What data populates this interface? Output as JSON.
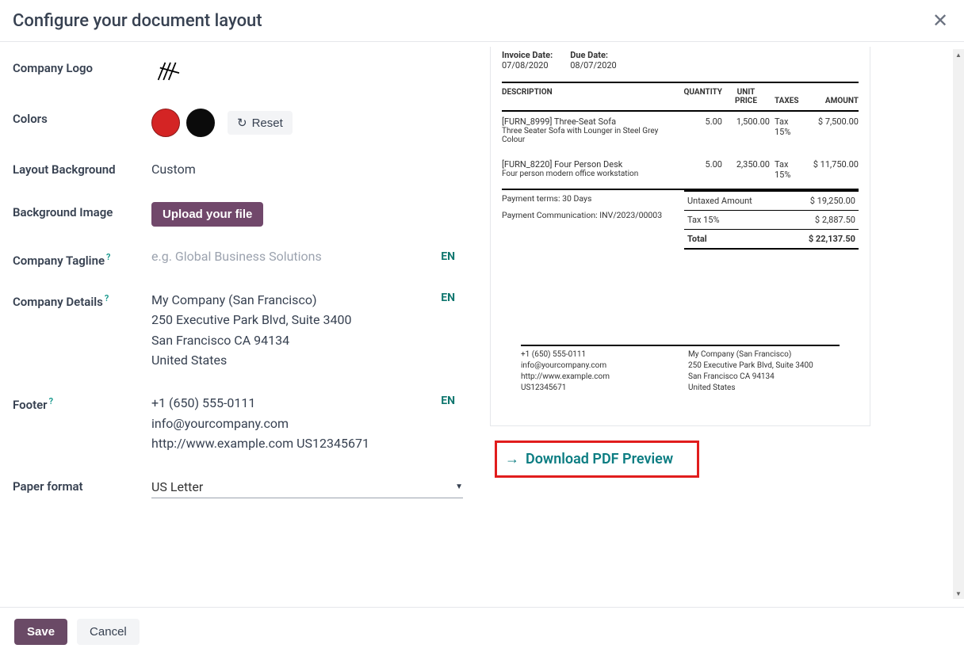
{
  "header": {
    "title": "Configure your document layout"
  },
  "form": {
    "labels": {
      "logo": "Company Logo",
      "colors": "Colors",
      "layout_bg": "Layout Background",
      "bg_image": "Background Image",
      "tagline": "Company Tagline",
      "details": "Company Details",
      "footer": "Footer",
      "paper": "Paper format"
    },
    "colors": {
      "primary": "#d42424",
      "secondary": "#0b0b0b",
      "reset_label": "Reset"
    },
    "layout_bg_value": "Custom",
    "upload_label": "Upload your file",
    "tagline_placeholder": "e.g. Global Business Solutions",
    "details_value": "My Company (San Francisco)\n250 Executive Park Blvd, Suite 3400\nSan Francisco CA 94134\nUnited States",
    "footer_value": "+1 (650) 555-0111\ninfo@yourcompany.com\nhttp://www.example.com US12345671",
    "lang_badge": "EN",
    "paper_value": "US Letter"
  },
  "preview": {
    "invoice_date_label": "Invoice Date:",
    "invoice_date": "07/08/2020",
    "due_date_label": "Due Date:",
    "due_date": "08/07/2020",
    "headers": {
      "desc": "DESCRIPTION",
      "qty": "QUANTITY",
      "unit": "UNIT",
      "price": "PRICE",
      "taxes": "TAXES",
      "amount": "AMOUNT"
    },
    "lines": [
      {
        "name": "[FURN_8999] Three-Seat Sofa",
        "sub": "Three Seater Sofa with Lounger in Steel Grey Colour",
        "qty": "5.00",
        "price": "1,500.00",
        "tax": "Tax 15%",
        "amount": "$ 7,500.00"
      },
      {
        "name": "[FURN_8220] Four Person Desk",
        "sub": "Four person modern office workstation",
        "qty": "5.00",
        "price": "2,350.00",
        "tax": "Tax 15%",
        "amount": "$ 11,750.00"
      }
    ],
    "pay_terms": "Payment terms: 30 Days",
    "comm": "Payment Communication: INV/2023/00003",
    "totals": {
      "untaxed_label": "Untaxed Amount",
      "untaxed": "$ 19,250.00",
      "tax_label": "Tax 15%",
      "tax": "$ 2,887.50",
      "total_label": "Total",
      "total": "$ 22,137.50"
    },
    "footer_col1": "+1 (650) 555-0111\ninfo@yourcompany.com\nhttp://www.example.com\nUS12345671",
    "footer_col2": "My Company (San Francisco)\n250 Executive Park Blvd, Suite 3400\nSan Francisco CA 94134\nUnited States",
    "download_label": "Download PDF Preview"
  },
  "footer": {
    "save": "Save",
    "cancel": "Cancel"
  }
}
